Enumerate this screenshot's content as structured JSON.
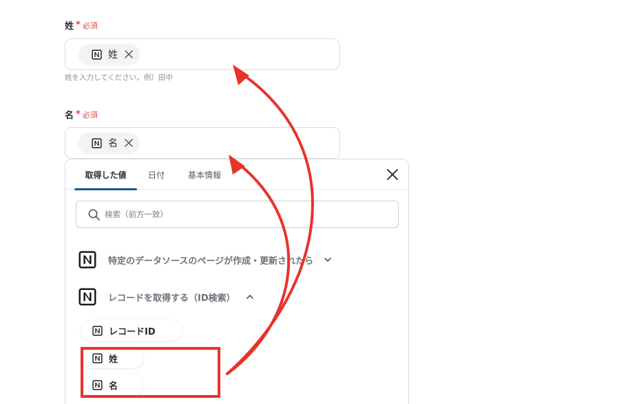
{
  "fields": [
    {
      "label": "姓",
      "required_text": "必須",
      "required_mark": "*",
      "chip": "姓",
      "hint": "姓を入力してください。例）田中"
    },
    {
      "label": "名",
      "required_text": "必須",
      "required_mark": "*",
      "chip": "名"
    }
  ],
  "panel": {
    "tabs": [
      {
        "label": "取得した値",
        "active": true
      },
      {
        "label": "日付",
        "active": false
      },
      {
        "label": "基本情報",
        "active": false
      }
    ],
    "search_placeholder": "検索（前方一致）",
    "groups": [
      {
        "label": "特定のデータソースのページが作成・更新されたら",
        "expanded": false,
        "chevron": "chevron-down-icon"
      },
      {
        "label": "レコードを取得する（ID検索）",
        "expanded": true,
        "chevron": "chevron-up-icon"
      }
    ],
    "items": [
      "レコードID",
      "姓",
      "名"
    ]
  },
  "colors": {
    "required": "#e5483a",
    "tab_underline": "#1a5b86",
    "annotation": "#e8332a"
  },
  "icons": [
    "notion-icon",
    "close-icon",
    "search-icon",
    "chevron-down-icon",
    "chevron-up-icon"
  ]
}
